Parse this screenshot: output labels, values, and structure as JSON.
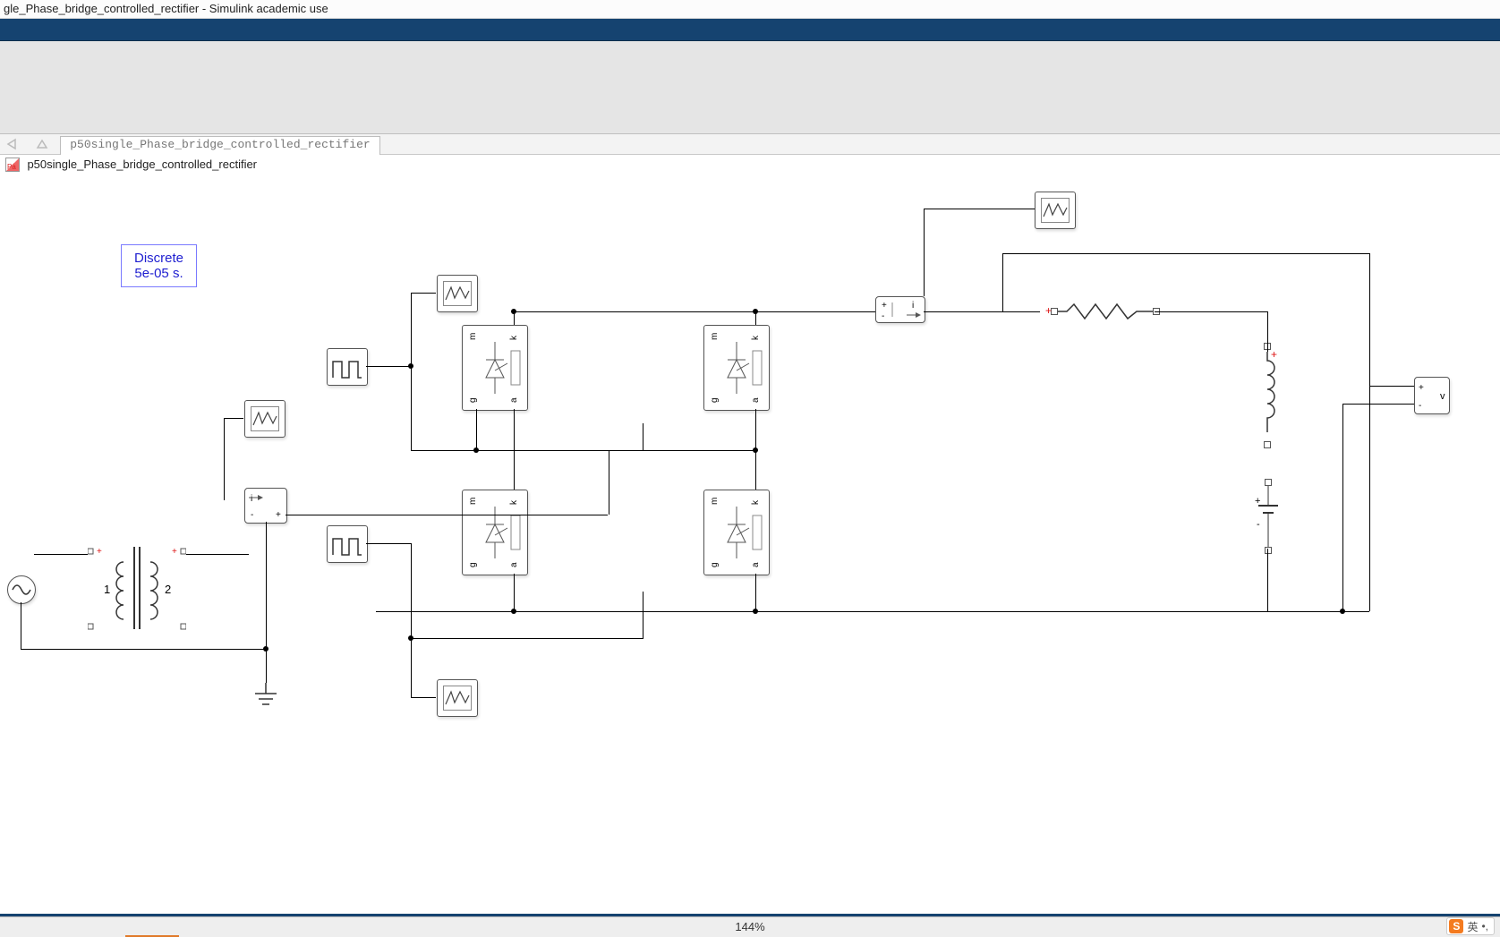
{
  "window": {
    "title": "gle_Phase_bridge_controlled_rectifier - Simulink academic use"
  },
  "nav": {
    "breadcrumb": "p50single_Phase_bridge_controlled_rectifier",
    "model_name": "p50single_Phase_bridge_controlled_rectifier"
  },
  "solver": {
    "line1": "Discrete",
    "line2": "5e-05 s."
  },
  "status": {
    "zoom": "144%"
  },
  "ime": {
    "badge_letter": "S",
    "lang": "英"
  },
  "blocks": {
    "thyristor_labels": {
      "m": "m",
      "k": "k",
      "g": "g",
      "a": "a"
    },
    "current_sensor": {
      "plus": "+",
      "minus": "-",
      "i_label": "i"
    },
    "voltage_sensor": {
      "plus": "+",
      "minus": "-",
      "v_label": "v"
    },
    "emf": {
      "plus": "+",
      "minus": "-"
    },
    "transformer": {
      "prim": "1",
      "sec": "2"
    }
  },
  "colors": {
    "brand_blue": "#154370",
    "accent_orange": "#f47b20",
    "solver_text": "#1e1ed0",
    "port_polarity": "#d11"
  }
}
